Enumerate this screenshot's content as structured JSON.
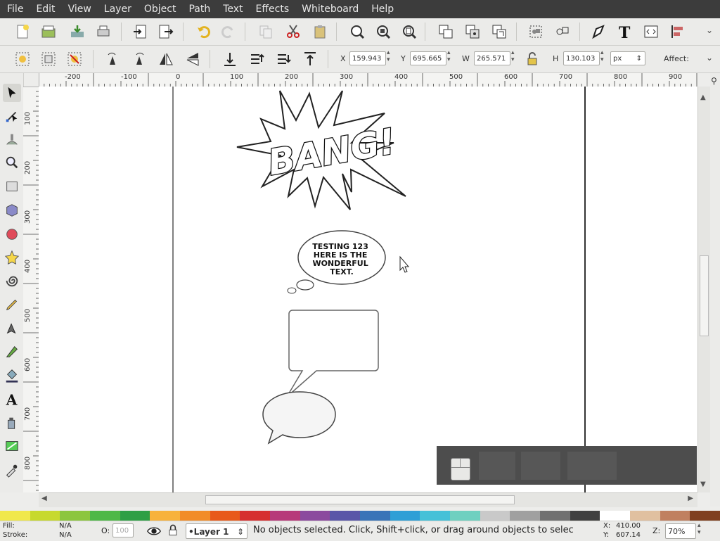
{
  "menu": [
    "File",
    "Edit",
    "View",
    "Layer",
    "Object",
    "Path",
    "Text",
    "Effects",
    "Whiteboard",
    "Help"
  ],
  "controls": {
    "x_label": "X",
    "x_value": "159.943",
    "y_label": "Y",
    "y_value": "695.665",
    "w_label": "W",
    "w_value": "265.571",
    "h_label": "H",
    "h_value": "130.103",
    "unit": "px",
    "affect_label": "Affect:"
  },
  "ruler": {
    "h_ticks": [
      "-200",
      "-100",
      "0",
      "100",
      "200",
      "300",
      "400",
      "500",
      "600",
      "700",
      "800",
      "900"
    ],
    "v_ticks": [
      "100",
      "200",
      "300",
      "400",
      "500",
      "600",
      "700",
      "800"
    ]
  },
  "canvas": {
    "bang_text": "BANG!",
    "bubble_text_lines": [
      "TESTING 123",
      "HERE IS THE",
      "WONDERFUL",
      "TEXT."
    ]
  },
  "palette": [
    "#f0e84b",
    "#c7d92e",
    "#8cc63f",
    "#4fb848",
    "#2e9f45",
    "#f7b23b",
    "#f28c28",
    "#e8591a",
    "#d62f2f",
    "#b73a7a",
    "#8b4a9e",
    "#5a56a8",
    "#3a74b8",
    "#2e9fd6",
    "#46c1d8",
    "#6fd0c0",
    "#c9c9c9",
    "#a0a0a0",
    "#707070",
    "#404040",
    "#ffffff",
    "#e0c0a0",
    "#c08060",
    "#804020"
  ],
  "status": {
    "fill_label": "Fill:",
    "fill_value": "N/A",
    "stroke_label": "Stroke:",
    "stroke_value": "N/A",
    "opacity_label": "O:",
    "opacity_value": "100",
    "layer": "•Layer 1",
    "message": "No objects selected. Click, Shift+click, or drag around objects to selec",
    "x_label": "X:",
    "x_value": "410.00",
    "y_label": "Y:",
    "y_value": "607.14",
    "zoom_label": "Z:",
    "zoom_value": "70%"
  }
}
